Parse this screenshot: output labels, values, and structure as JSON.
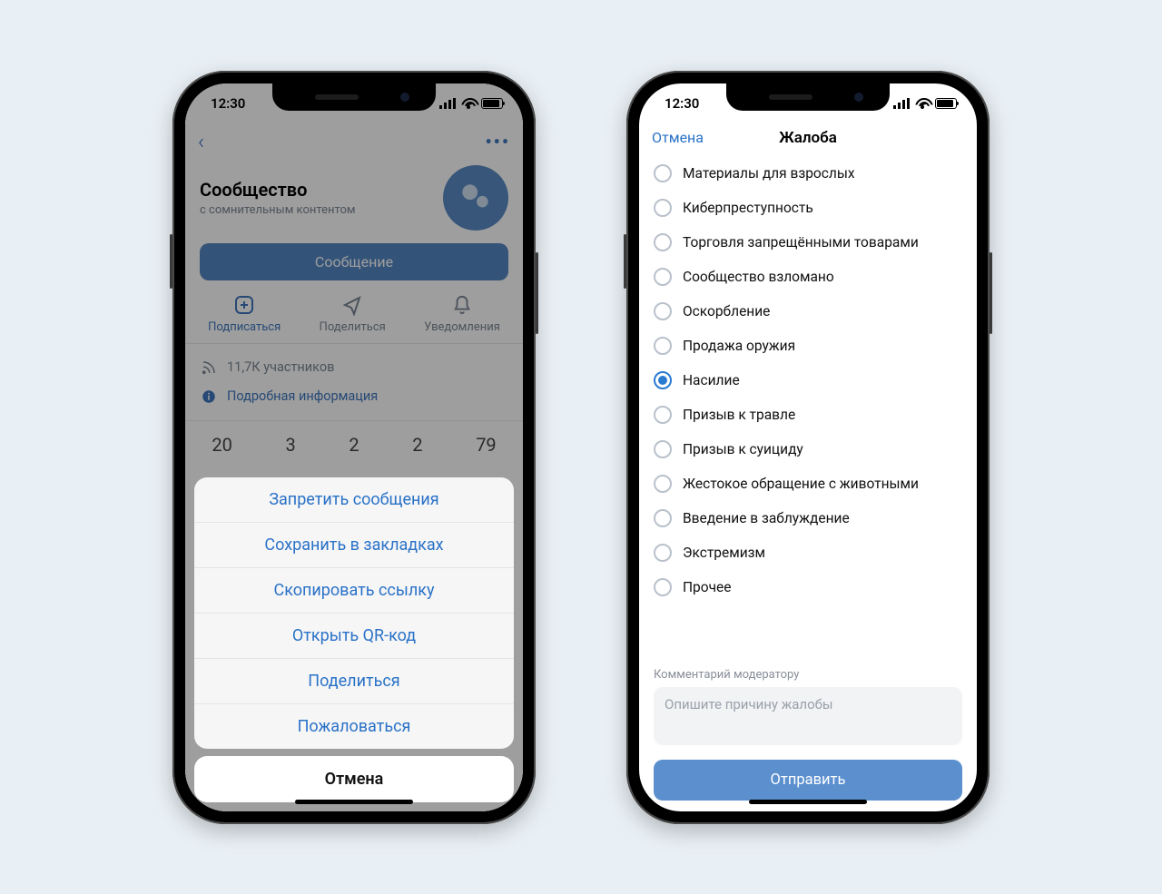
{
  "status_time": "12:30",
  "left": {
    "community_name": "Сообщество",
    "community_sub": "с сомнительным контентом",
    "message_button": "Сообщение",
    "actions": {
      "subscribe": "Подписаться",
      "share": "Поделиться",
      "notify": "Уведомления"
    },
    "members": "11,7К участников",
    "details": "Подробная информация",
    "counters": [
      "20",
      "3",
      "2",
      "2",
      "79"
    ],
    "sheet": {
      "items": [
        "Запретить сообщения",
        "Сохранить в закладках",
        "Скопировать ссылку",
        "Открыть QR-код",
        "Поделиться",
        "Пожаловаться"
      ],
      "cancel": "Отмена"
    }
  },
  "right": {
    "cancel": "Отмена",
    "title": "Жалоба",
    "reasons": [
      {
        "label": "Материалы для взрослых",
        "selected": false
      },
      {
        "label": "Киберпреступность",
        "selected": false
      },
      {
        "label": "Торговля запрещёнными товарами",
        "selected": false
      },
      {
        "label": "Сообщество взломано",
        "selected": false
      },
      {
        "label": "Оскорбление",
        "selected": false
      },
      {
        "label": "Продажа оружия",
        "selected": false
      },
      {
        "label": "Насилие",
        "selected": true
      },
      {
        "label": "Призыв к травле",
        "selected": false
      },
      {
        "label": "Призыв к суициду",
        "selected": false
      },
      {
        "label": "Жестокое обращение с животными",
        "selected": false
      },
      {
        "label": "Введение в заблуждение",
        "selected": false
      },
      {
        "label": "Экстремизм",
        "selected": false
      },
      {
        "label": "Прочее",
        "selected": false
      }
    ],
    "comment_label": "Комментарий модератору",
    "comment_placeholder": "Опишите причину жалобы",
    "send": "Отправить"
  }
}
